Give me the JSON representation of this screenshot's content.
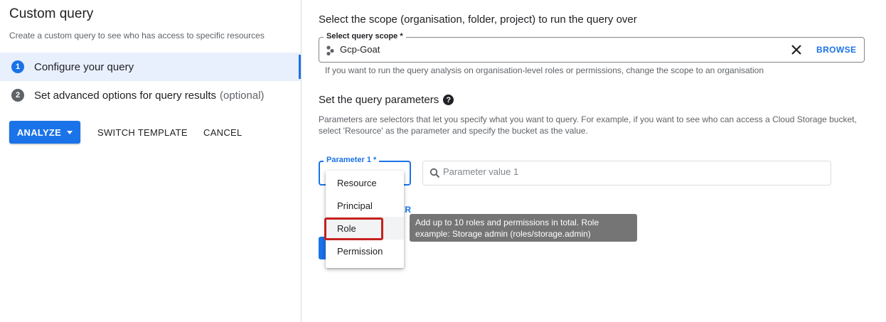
{
  "left": {
    "title": "Custom query",
    "subtitle": "Create a custom query to see who has access to specific resources",
    "steps": [
      {
        "number": "1",
        "label": "Configure your query",
        "optional": ""
      },
      {
        "number": "2",
        "label": "Set advanced options for query results",
        "optional": "(optional)"
      }
    ],
    "buttons": {
      "analyze": "ANALYZE",
      "switch_template": "SWITCH TEMPLATE",
      "cancel": "CANCEL"
    }
  },
  "scope": {
    "heading": "Select the scope (organisation, folder, project) to run the query over",
    "field_label": "Select query scope *",
    "value": "Gcp-Goat",
    "browse": "BROWSE",
    "hint": "If you want to run the query analysis on organisation-level roles or permissions, change the scope to an organisation"
  },
  "params": {
    "heading": "Set the query parameters",
    "help_icon": "?",
    "description": "Parameters are selectors that let you specify what you want to query. For example, if you want to see who can access a Cloud Storage bucket, select 'Resource' as the parameter and specify the bucket as the value.",
    "param1_label": "Parameter 1 *",
    "value_placeholder": "Parameter value 1",
    "add_parameter_partial": "ER"
  },
  "menu": {
    "items": [
      "Resource",
      "Principal",
      "Role",
      "Permission"
    ],
    "highlighted": "Role"
  },
  "tooltip": {
    "text": "Add up to 10 roles and permissions in total. Role example: Storage admin (roles/storage.admin)"
  },
  "colors": {
    "accent": "#1a73e8",
    "highlight_box": "#c5221f",
    "tooltip_bg": "#757575"
  }
}
